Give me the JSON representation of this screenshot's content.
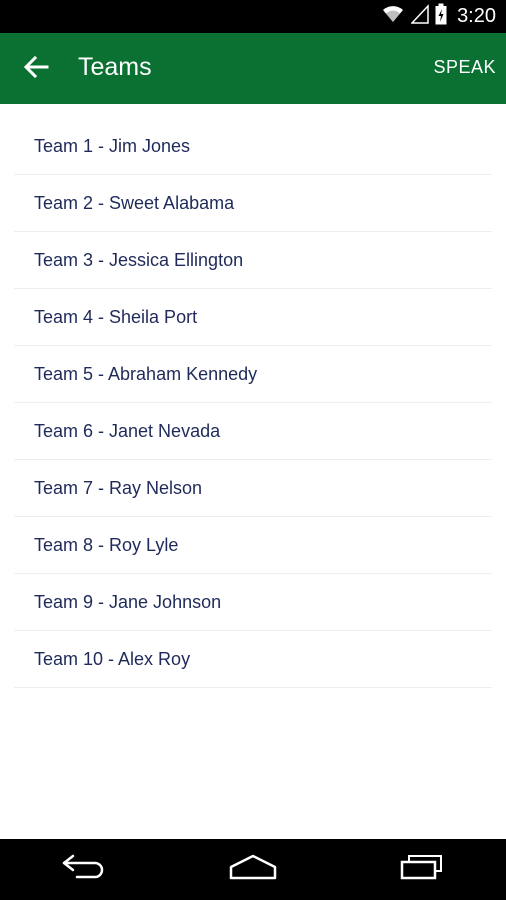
{
  "status_bar": {
    "time": "3:20"
  },
  "app_bar": {
    "title": "Teams",
    "action_label": "SPEAK"
  },
  "teams": [
    {
      "label": "Team 1 - Jim Jones"
    },
    {
      "label": "Team 2 - Sweet Alabama"
    },
    {
      "label": "Team 3 - Jessica Ellington"
    },
    {
      "label": "Team 4 - Sheila Port"
    },
    {
      "label": "Team 5 - Abraham Kennedy"
    },
    {
      "label": "Team 6 - Janet Nevada"
    },
    {
      "label": "Team 7 - Ray Nelson"
    },
    {
      "label": "Team 8 - Roy Lyle"
    },
    {
      "label": "Team 9 - Jane Johnson"
    },
    {
      "label": "Team 10 - Alex Roy"
    }
  ],
  "icons": {
    "back": "arrow-left-icon",
    "wifi": "wifi-icon",
    "signal": "signal-icon",
    "battery": "battery-icon",
    "nav_back": "nav-back-icon",
    "nav_home": "nav-home-icon",
    "nav_recents": "nav-recents-icon"
  },
  "colors": {
    "app_bar": "#0a7132",
    "list_text": "#1f2a5a",
    "divider": "#eeeeee"
  }
}
